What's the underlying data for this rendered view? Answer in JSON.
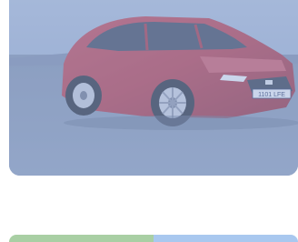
{
  "hero": {
    "image_subject": "red-hatchback-car-photo",
    "license_plate": "1101 LFE",
    "overlay_color": "#a0b6dc"
  },
  "next_card": {
    "colors": [
      "#a9cfa4",
      "#a9c8ef"
    ]
  }
}
